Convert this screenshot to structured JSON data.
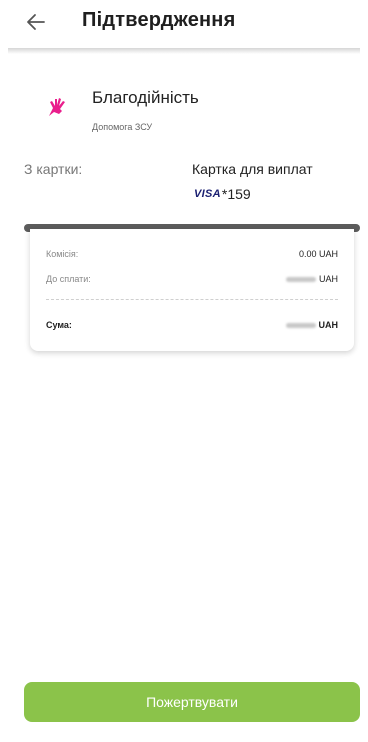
{
  "header": {
    "title": "Підтвердження",
    "back_icon": "arrow-left-icon"
  },
  "service": {
    "icon": "hand-icon",
    "icon_color": "#e91e8c",
    "name": "Благодійність",
    "subtitle": "Допомога ЗСУ"
  },
  "payment": {
    "from_label": "З картки:",
    "card_name": "Картка для виплат",
    "card_brand": "VISA",
    "card_number": "*159"
  },
  "receipt": {
    "commission_label": "Комісія:",
    "commission_value": "0.00 UAH",
    "to_pay_label": "До сплати:",
    "to_pay_currency": "UAH",
    "sum_label": "Сума:",
    "sum_currency": "UAH"
  },
  "actions": {
    "donate_label": "Пожертвувати",
    "accent": "#8bc34a"
  }
}
